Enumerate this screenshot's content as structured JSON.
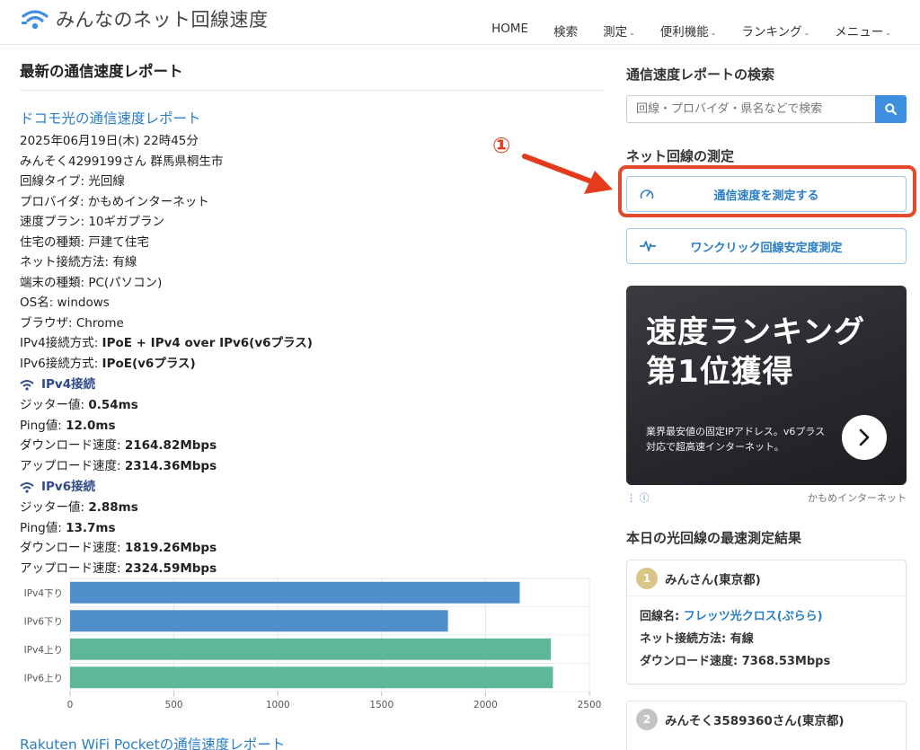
{
  "site": {
    "title": "みんなのネット回線速度"
  },
  "nav": [
    {
      "label": "HOME",
      "dropdown": false
    },
    {
      "label": "検索",
      "dropdown": false
    },
    {
      "label": "測定",
      "dropdown": true
    },
    {
      "label": "便利機能",
      "dropdown": true
    },
    {
      "label": "ランキング",
      "dropdown": true
    },
    {
      "label": "メニュー",
      "dropdown": true
    }
  ],
  "main": {
    "heading": "最新の通信速度レポート",
    "report": {
      "title": "ドコモ光の通信速度レポート",
      "lines": [
        {
          "text": "2025年06月19日(木) 22時45分"
        },
        {
          "text": "みんそく4299199さん 群馬県桐生市"
        },
        {
          "text": "回線タイプ: 光回線"
        },
        {
          "text": "プロバイダ: かもめインターネット"
        },
        {
          "text": "速度プラン: 10ギガプラン"
        },
        {
          "text": "住宅の種類: 戸建て住宅"
        },
        {
          "text": "ネット接続方法: 有線"
        },
        {
          "text": "端末の種類: PC(パソコン)"
        },
        {
          "text": "OS名: windows"
        },
        {
          "text": "ブラウザ: Chrome"
        }
      ],
      "ipv4_method_label": "IPv4接続方式: ",
      "ipv4_method": "IPoE + IPv4 over IPv6(v6プラス)",
      "ipv6_method_label": "IPv6接続方式: ",
      "ipv6_method": "IPoE(v6プラス)",
      "ipv4": {
        "heading": "IPv4接続",
        "jitter_label": "ジッター値: ",
        "jitter": "0.54ms",
        "ping_label": "Ping値: ",
        "ping": "12.0ms",
        "down_label": "ダウンロード速度: ",
        "down": "2164.82Mbps",
        "up_label": "アップロード速度: ",
        "up": "2314.36Mbps"
      },
      "ipv6": {
        "heading": "IPv6接続",
        "jitter_label": "ジッター値: ",
        "jitter": "2.88ms",
        "ping_label": "Ping値: ",
        "ping": "13.7ms",
        "down_label": "ダウンロード速度: ",
        "down": "1819.26Mbps",
        "up_label": "アップロード速度: ",
        "up": "2324.59Mbps"
      }
    },
    "next_report_title": "Rakuten WiFi Pocketの通信速度レポート"
  },
  "chart_data": {
    "type": "bar",
    "orientation": "horizontal",
    "categories": [
      "IPv4下り",
      "IPv6下り",
      "IPv4上り",
      "IPv6上り"
    ],
    "values": [
      2164.82,
      1819.26,
      2314.36,
      2324.59
    ],
    "colors": [
      "#4f8fcc",
      "#4f8fcc",
      "#5db89a",
      "#5db89a"
    ],
    "xlim": [
      0,
      2500
    ],
    "xticks": [
      0,
      500,
      1000,
      1500,
      2000,
      2500
    ],
    "grid": true,
    "title": "",
    "xlabel": "",
    "ylabel": ""
  },
  "sidebar": {
    "search_heading": "通信速度レポートの検索",
    "search_placeholder": "回線・プロバイダ・県名などで検索",
    "measure_heading": "ネット回線の測定",
    "measure_button": "通信速度を測定する",
    "stability_button": "ワンクリック回線安定度測定",
    "ad": {
      "title_line1": "速度ランキング",
      "title_line2": "第1位獲得",
      "sub_line1": "業界最安値の固定IPアドレス。v6プラス",
      "sub_line2": "対応で超高速インターネット。",
      "advertiser": "かもめインターネット"
    },
    "fastest_heading": "本日の光回線の最速測定結果",
    "results": [
      {
        "rank": "1",
        "rank_color": "#d9c48a",
        "user": "みんさん(東京都)",
        "line_label": "回線名: ",
        "line": "フレッツ光クロス(ぷらら)",
        "conn": "ネット接続方法: 有線",
        "down": "ダウンロード速度: 7368.53Mbps"
      },
      {
        "rank": "2",
        "rank_color": "#c4c4c4",
        "user": "みんそく3589360さん(東京都)"
      }
    ]
  },
  "annotation": {
    "marker": "①",
    "color": "#e3492c"
  }
}
